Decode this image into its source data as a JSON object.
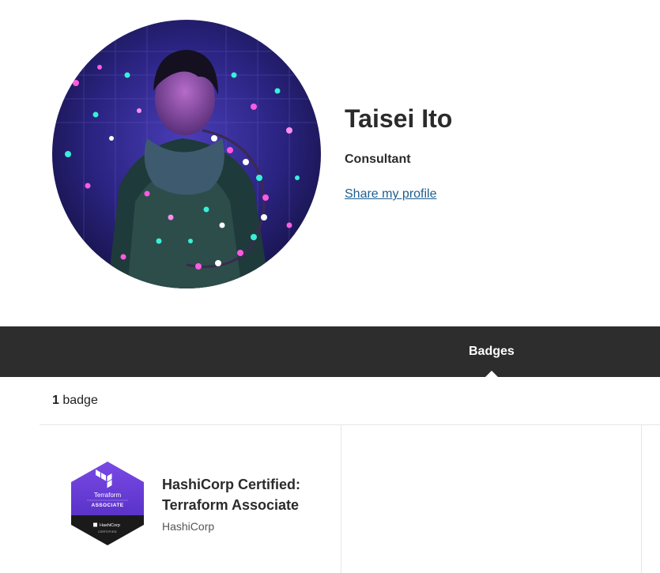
{
  "profile": {
    "name": "Taisei Ito",
    "title": "Consultant",
    "share_link": "Share my profile"
  },
  "tabs": [
    {
      "label": "Badges",
      "active": true
    }
  ],
  "badges_section": {
    "count": "1",
    "count_label": "badge",
    "items": [
      {
        "name": "HashiCorp Certified: Terraform Associate",
        "issuer": "HashiCorp",
        "image_text": {
          "product": "Terraform",
          "level": "ASSOCIATE",
          "brand": "HashiCorp",
          "footer": "CERTIFIED"
        }
      }
    ]
  },
  "colors": {
    "tabbar_bg": "#2d2d2d",
    "link": "#1d5e8f",
    "badge_purple": "#6b3fd9",
    "badge_dark": "#1a1a1a"
  }
}
